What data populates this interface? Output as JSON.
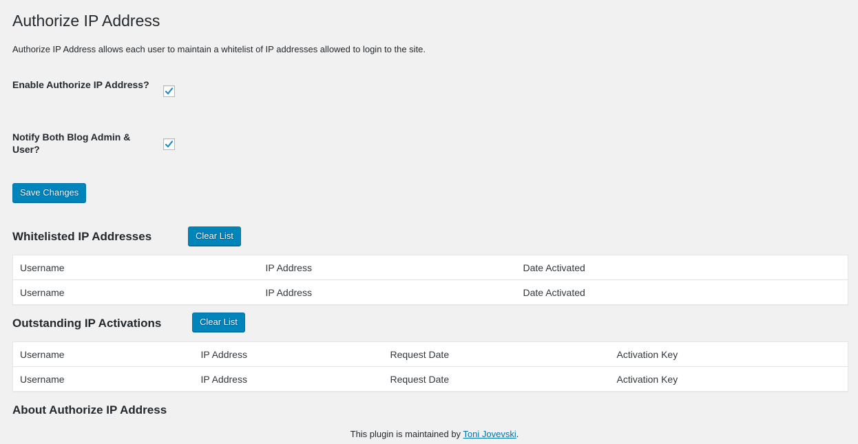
{
  "page": {
    "title": "Authorize IP Address",
    "description": "Authorize IP Address allows each user to maintain a whitelist of IP addresses allowed to login to the site."
  },
  "settings": {
    "enable_label": "Enable Authorize IP Address?",
    "enable_checked": true,
    "notify_label": "Notify Both Blog Admin & User?",
    "notify_checked": true,
    "save_label": "Save Changes"
  },
  "whitelist": {
    "title": "Whitelisted IP Addresses",
    "clear_label": "Clear List",
    "headers": [
      "Username",
      "IP Address",
      "Date Activated"
    ],
    "rows": [
      [
        "Username",
        "IP Address",
        "Date Activated"
      ]
    ]
  },
  "outstanding": {
    "title": "Outstanding IP Activations",
    "clear_label": "Clear List",
    "headers": [
      "Username",
      "IP Address",
      "Request Date",
      "Activation Key"
    ],
    "rows": [
      [
        "Username",
        "IP Address",
        "Request Date",
        "Activation Key"
      ]
    ]
  },
  "about": {
    "title": "About Authorize IP Address",
    "text_before": "This plugin is maintained by ",
    "author": "Toni Jovevski",
    "text_after": "."
  },
  "colors": {
    "background": "#f1f1f1",
    "primary": "#0085ba",
    "link": "#0073aa",
    "checkmark": "#1e8cbe"
  }
}
